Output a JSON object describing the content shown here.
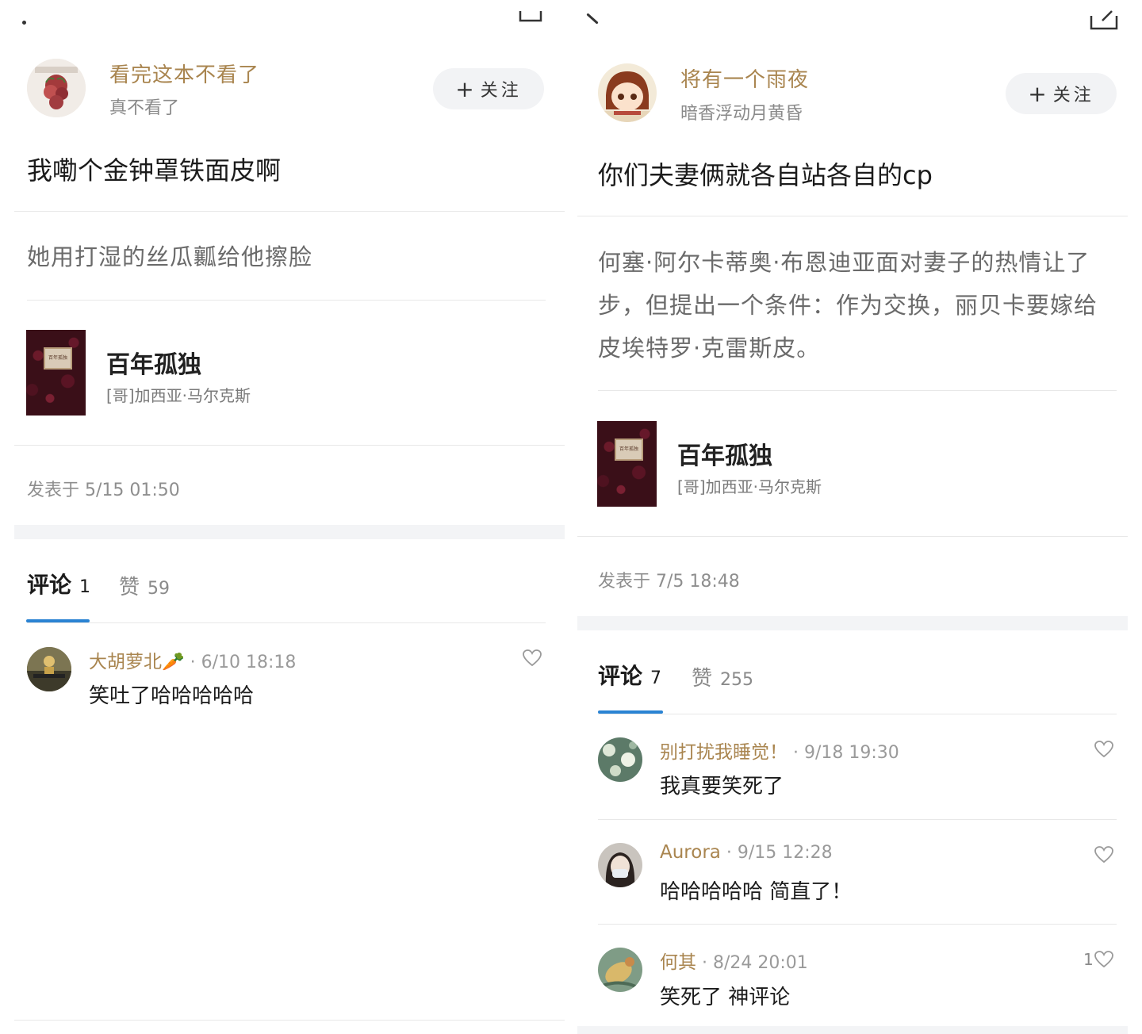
{
  "left": {
    "user": {
      "name": "看完这本不看了",
      "signature": "真不看了"
    },
    "follow_label": "关注",
    "headline": "我嘞个金钟罩铁面皮啊",
    "quote": "她用打湿的丝瓜瓤给他擦脸",
    "book": {
      "title": "百年孤独",
      "author": "[哥]加西亚·马尔克斯",
      "cover_text": "百年孤独"
    },
    "posted": "发表于 5/15 01:50",
    "tabs": {
      "comments_label": "评论",
      "comments_count": "1",
      "likes_label": "赞",
      "likes_count": "59"
    },
    "comments": [
      {
        "name": "大胡萝北🥕",
        "time": "· 6/10 18:18",
        "text": "笑吐了哈哈哈哈哈",
        "likes": ""
      }
    ]
  },
  "right": {
    "user": {
      "name": "将有一个雨夜",
      "signature": "暗香浮动月黄昏"
    },
    "follow_label": "关注",
    "headline": "你们夫妻俩就各自站各自的cp",
    "quote": "何塞·阿尔卡蒂奥·布恩迪亚面对妻子的热情让了步，但提出一个条件：作为交换，丽贝卡要嫁给皮埃特罗·克雷斯皮。",
    "book": {
      "title": "百年孤独",
      "author": "[哥]加西亚·马尔克斯",
      "cover_text": "百年孤独"
    },
    "posted": "发表于 7/5 18:48",
    "tabs": {
      "comments_label": "评论",
      "comments_count": "7",
      "likes_label": "赞",
      "likes_count": "255"
    },
    "comments": [
      {
        "name": "别打扰我睡觉！",
        "time": "· 9/18 19:30",
        "text": "我真要笑死了",
        "likes": ""
      },
      {
        "name": "Aurora",
        "time": "· 9/15 12:28",
        "text": "哈哈哈哈哈 简直了！",
        "likes": ""
      },
      {
        "name": "何其",
        "time": "· 8/24 20:01",
        "text": "笑死了 神评论",
        "likes": "1"
      }
    ]
  },
  "colors": {
    "accent_name": "#a9854f",
    "tab_underline": "#2a83d3",
    "follow_bg": "#f2f3f5"
  },
  "icons": [
    "back-icon",
    "share-icon",
    "plus-icon",
    "heart-icon"
  ]
}
